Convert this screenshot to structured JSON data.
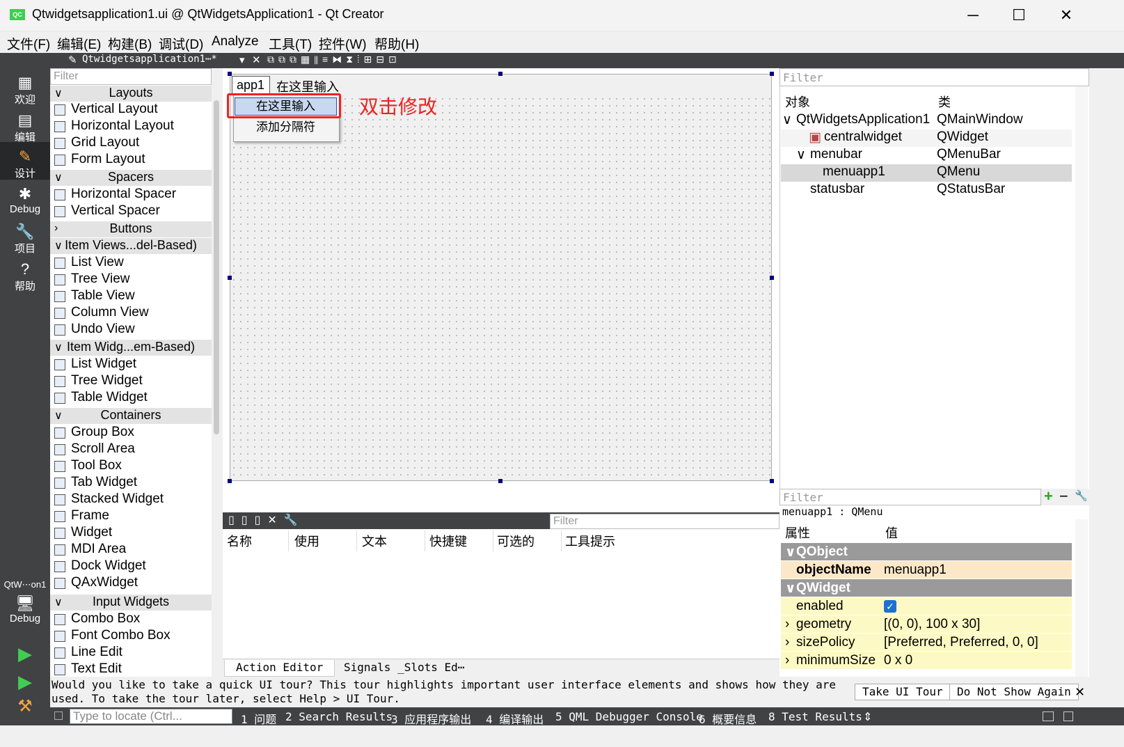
{
  "window": {
    "title": "Qtwidgetsapplication1.ui @ QtWidgetsApplication1 - Qt Creator",
    "logo_text": "QC",
    "min": "─",
    "max": "☐",
    "close": "✕"
  },
  "menubar": [
    "文件(F)",
    "编辑(E)",
    "构建(B)",
    "调试(D)",
    "Analyze",
    "工具(T)",
    "控件(W)",
    "帮助(H)"
  ],
  "modes": [
    {
      "label": "欢迎",
      "icon": "▦"
    },
    {
      "label": "编辑",
      "icon": "▤"
    },
    {
      "label": "设计",
      "icon": "✎"
    },
    {
      "label": "Debug",
      "icon": "✱"
    },
    {
      "label": "项目",
      "icon": "🔧"
    },
    {
      "label": "帮助",
      "icon": "?"
    }
  ],
  "kit": {
    "project": "QtW⋯on1",
    "config": "Debug",
    "config_icon": "🖥"
  },
  "toolbar": {
    "file": "Qtwidgetsapplication1⋯*",
    "dropdown": "▾",
    "close": "✕"
  },
  "widgetbox": {
    "filter_placeholder": "Filter",
    "categories": {
      "layouts": "Layouts",
      "spacers": "Spacers",
      "buttons": "Buttons",
      "item_views": "Item Views...del-Based)",
      "item_widgets": "Item Widg...em-Based)",
      "containers": "Containers",
      "input": "Input Widgets"
    },
    "items": {
      "vertical_layout": "Vertical Layout",
      "horizontal_layout": "Horizontal Layout",
      "grid_layout": "Grid Layout",
      "form_layout": "Form Layout",
      "horizontal_spacer": "Horizontal Spacer",
      "vertical_spacer": "Vertical Spacer",
      "list_view": "List View",
      "tree_view": "Tree View",
      "table_view": "Table View",
      "column_view": "Column View",
      "undo_view": "Undo View",
      "list_widget": "List Widget",
      "tree_widget": "Tree Widget",
      "table_widget": "Table Widget",
      "group_box": "Group Box",
      "scroll_area": "Scroll Area",
      "tool_box": "Tool Box",
      "tab_widget": "Tab Widget",
      "stacked_widget": "Stacked Widget",
      "frame": "Frame",
      "widget": "Widget",
      "mdi_area": "MDI Area",
      "dock_widget": "Dock Widget",
      "qax_widget": "QAxWidget",
      "combo_box": "Combo Box",
      "font_combo_box": "Font Combo Box",
      "line_edit": "Line Edit",
      "text_edit": "Text Edit"
    }
  },
  "form": {
    "menu_app1": "app1",
    "menu_type_here": "在这里输入",
    "dropdown_type_here": "在这里输入",
    "dropdown_add_separator": "添加分隔符",
    "annotation": "双击修改"
  },
  "action_editor": {
    "filter_placeholder": "Filter",
    "columns": [
      "名称",
      "使用",
      "文本",
      "快捷键",
      "可选的",
      "工具提示"
    ],
    "tabs": [
      "Action Editor",
      "Signals _Slots Ed⋯"
    ]
  },
  "object_inspector": {
    "filter_placeholder": "Filter",
    "headers": [
      "对象",
      "类"
    ],
    "rows": [
      {
        "object": "QtWidgetsApplication1",
        "class": "QMainWindow"
      },
      {
        "object": "centralwidget",
        "class": "QWidget"
      },
      {
        "object": "menubar",
        "class": "QMenuBar"
      },
      {
        "object": "menuapp1",
        "class": "QMenu"
      },
      {
        "object": "statusbar",
        "class": "QStatusBar"
      }
    ]
  },
  "property_editor": {
    "filter_placeholder": "Filter",
    "add": "+",
    "remove": "−",
    "configure": "🔧",
    "caption": "menuapp1 : QMenu",
    "headers": [
      "属性",
      "值"
    ],
    "sections": [
      "QObject",
      "QWidget"
    ],
    "rows": [
      {
        "key": "objectName",
        "value": "menuapp1"
      },
      {
        "key": "enabled",
        "value": "✓"
      },
      {
        "key": "geometry",
        "value": "[(0, 0), 100 x 30]"
      },
      {
        "key": "sizePolicy",
        "value": "[Preferred, Preferred, 0, 0]"
      },
      {
        "key": "minimumSize",
        "value": "0 x 0"
      }
    ]
  },
  "tour": {
    "message": "Would you like to take a quick UI tour? This tour highlights important user interface elements and shows how they are used. To take the tour later, select Help > UI Tour.",
    "take": "Take UI Tour",
    "dont_show": "Do Not Show Again",
    "close": "✕"
  },
  "statusbar": {
    "locate_placeholder": "Type to locate (Ctrl...",
    "items": [
      "1 问题",
      "2 Search Results",
      "3 应用程序输出",
      "4 编译输出",
      "5 QML Debugger Console",
      "6 概要信息",
      "8 Test Results"
    ],
    "more": "⇕"
  },
  "colors": {
    "accent_red": "#ee2222",
    "sidebar": "#404244",
    "qt_green": "#41cd52"
  }
}
